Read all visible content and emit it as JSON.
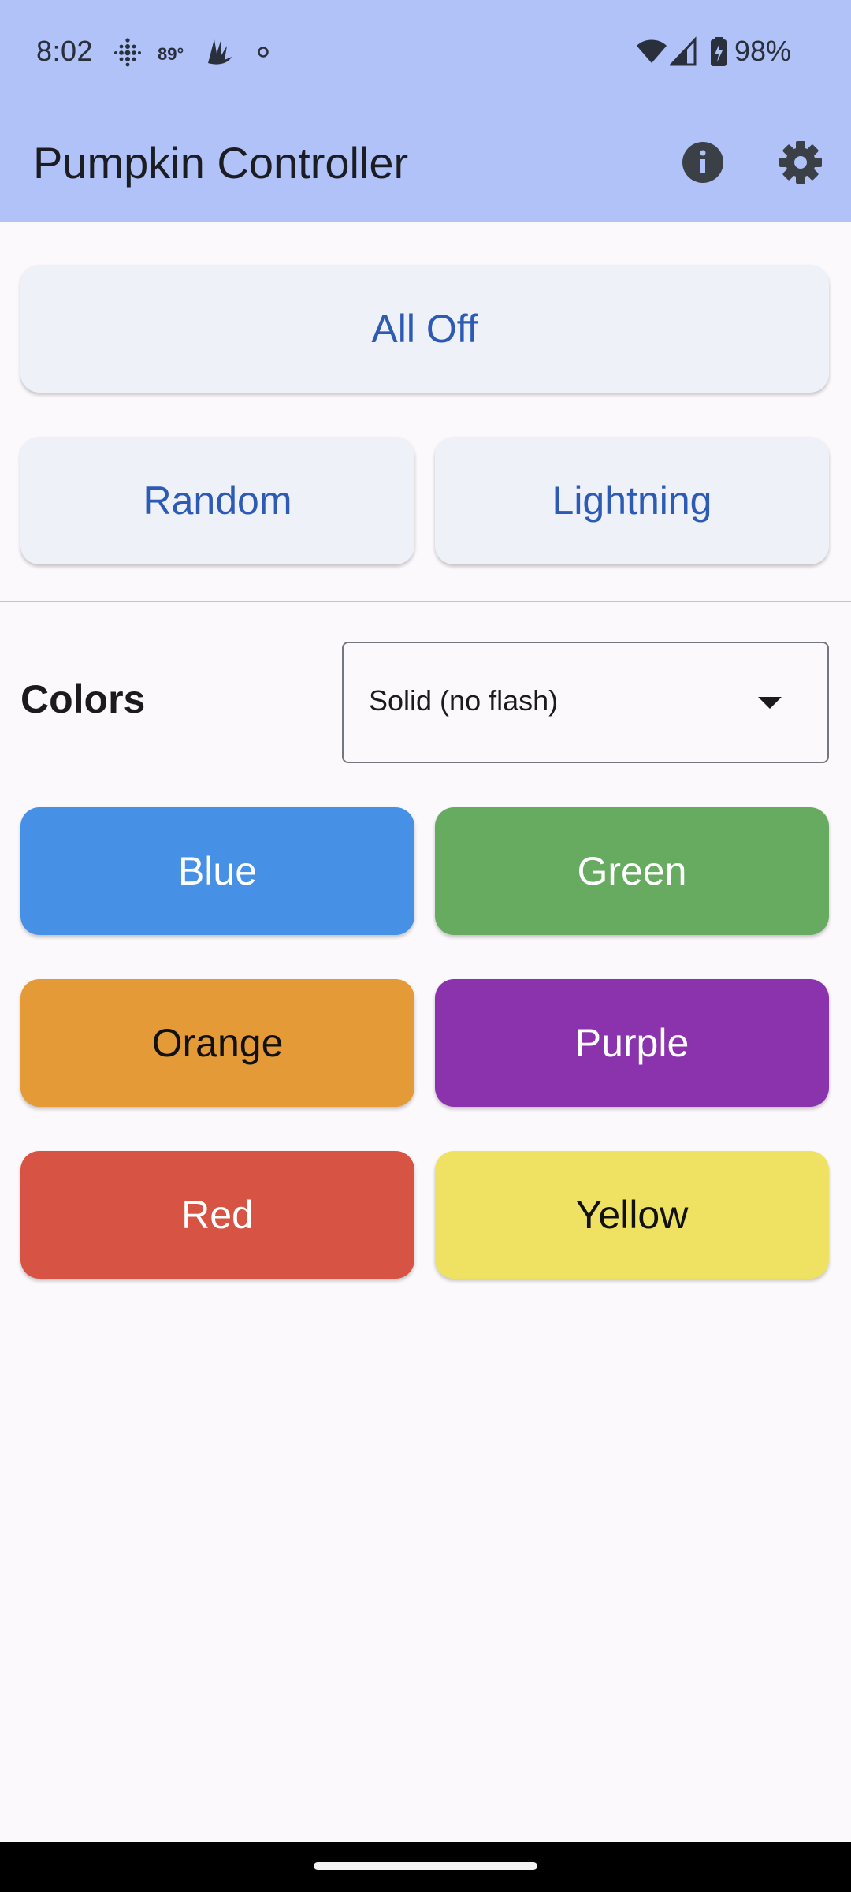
{
  "status_bar": {
    "time": "8:02",
    "temperature": "89°",
    "battery": "98%",
    "icons": [
      "fitbit-icon",
      "weather-icon",
      "app-notification-icon",
      "dot-icon",
      "wifi-icon",
      "signal-icon",
      "battery-charging-icon"
    ]
  },
  "app_bar": {
    "title": "Pumpkin Controller",
    "actions": [
      "info-icon",
      "settings-gear-icon"
    ],
    "background": "#b0c2f7"
  },
  "controls": {
    "all_off": "All Off",
    "random": "Random",
    "lightning": "Lightning"
  },
  "colors_section": {
    "label": "Colors",
    "mode_selected": "Solid (no flash)"
  },
  "color_buttons": [
    {
      "label": "Blue",
      "bg": "#4690e6",
      "fg": "#ffffff"
    },
    {
      "label": "Green",
      "bg": "#67ab61",
      "fg": "#ffffff"
    },
    {
      "label": "Orange",
      "bg": "#e49a37",
      "fg": "#111111"
    },
    {
      "label": "Purple",
      "bg": "#8a33ac",
      "fg": "#ffffff"
    },
    {
      "label": "Red",
      "bg": "#d75344",
      "fg": "#ffffff"
    },
    {
      "label": "Yellow",
      "bg": "#efe262",
      "fg": "#111111"
    }
  ]
}
